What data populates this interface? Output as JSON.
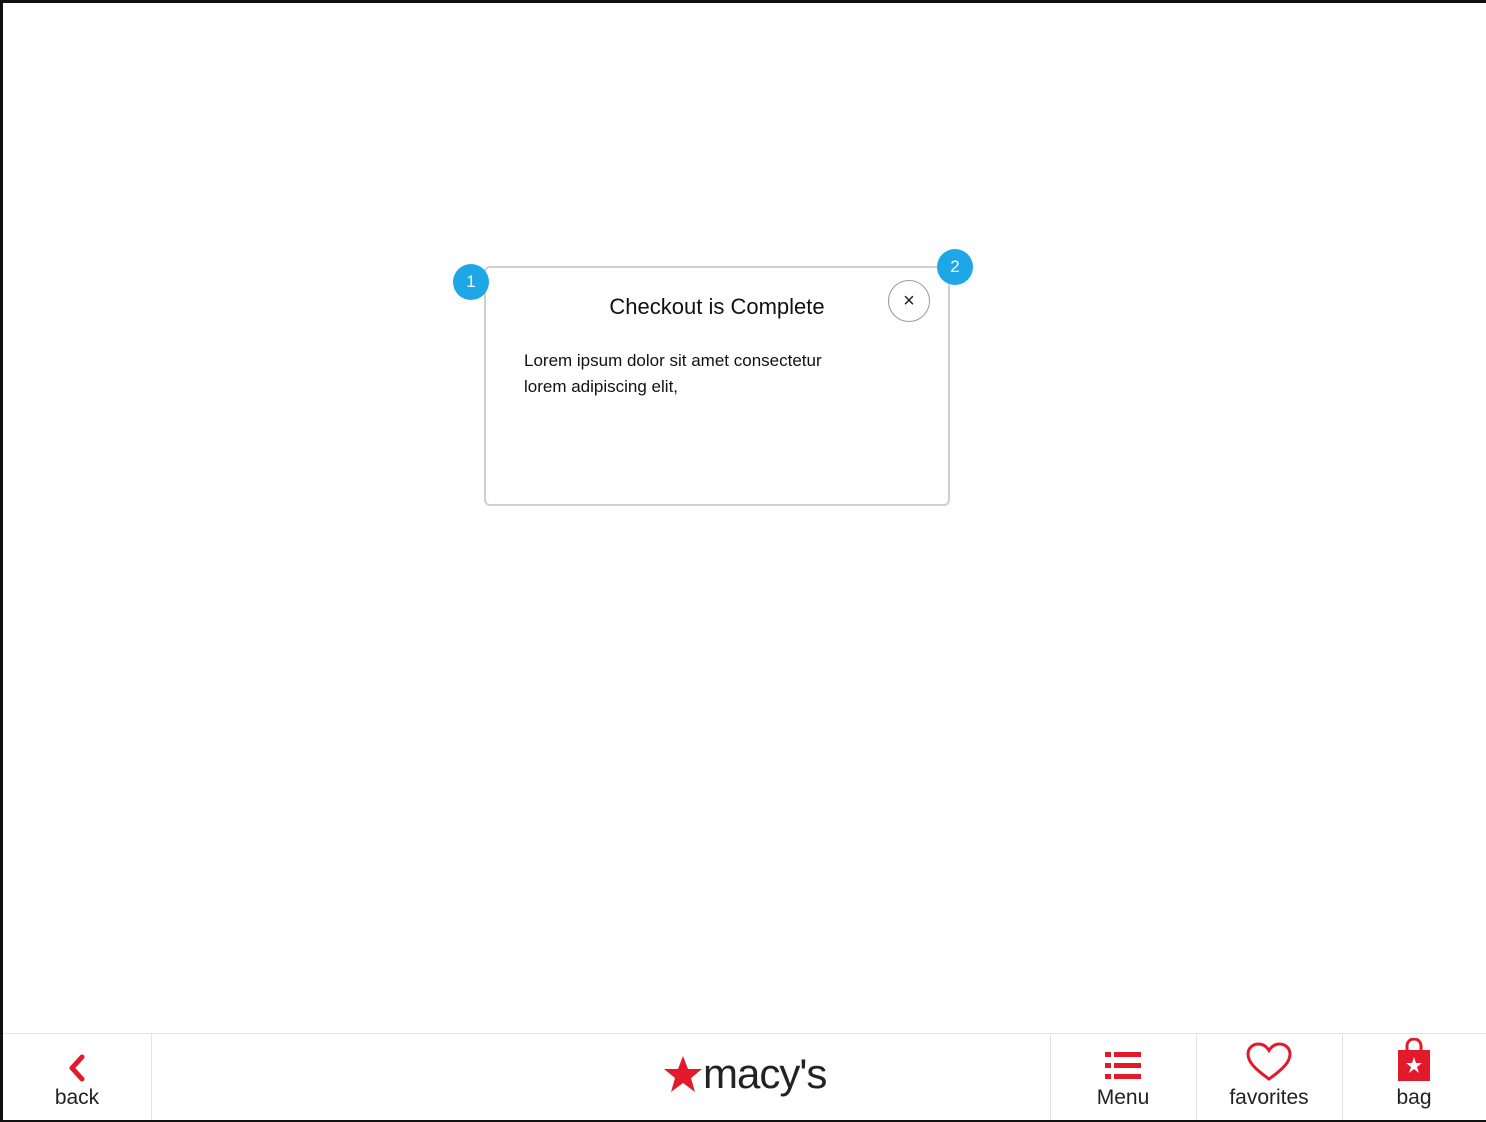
{
  "modal": {
    "title": "Checkout is Complete",
    "body_line1": "Lorem ipsum dolor sit amet consectetur",
    "body_line2": "lorem adipiscing elit,",
    "close_glyph": "×"
  },
  "markers": {
    "first": "1",
    "second": "2"
  },
  "bottom_nav": {
    "back_label": "back",
    "logo_text": "macy's",
    "menu_label": "Menu",
    "favorites_label": "favorites",
    "bag_label": "bag"
  },
  "colors": {
    "brand_red": "#e21a2c",
    "marker_blue": "#1ea7e7"
  },
  "icons": {
    "back": "chevron-left-icon",
    "menu": "list-icon",
    "favorites": "heart-icon",
    "bag": "shopping-bag-icon",
    "logo_star": "star-icon"
  }
}
